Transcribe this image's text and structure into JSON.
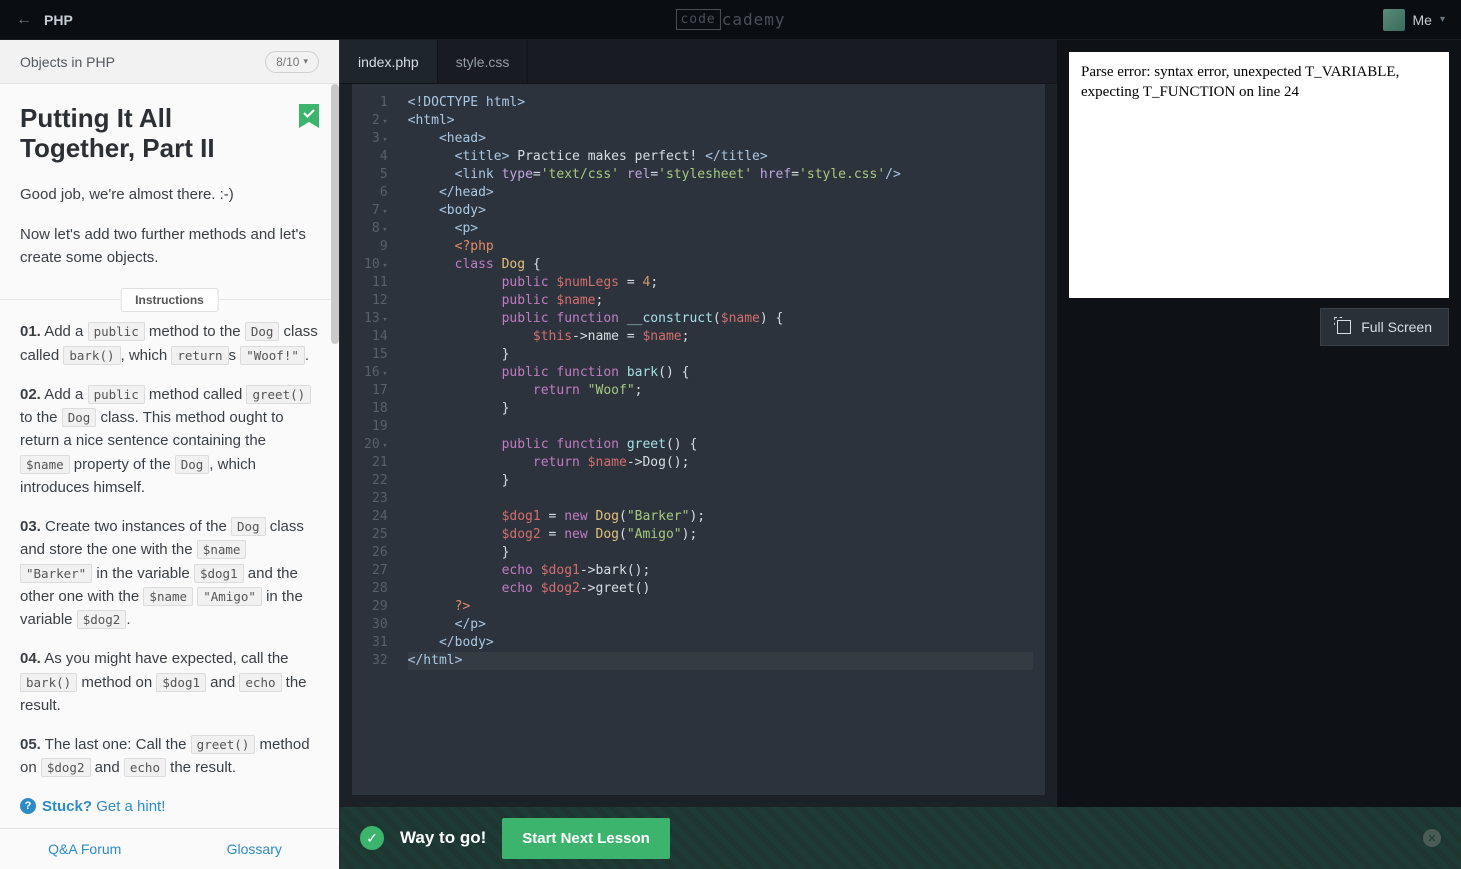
{
  "header": {
    "language": "PHP",
    "logo_left": "code",
    "logo_right": "cademy",
    "user_label": "Me"
  },
  "left": {
    "topic": "Objects in PHP",
    "progress": "8/10",
    "lesson_title": "Putting It All Together, Part II",
    "intro1": "Good job, we're almost there. :-)",
    "intro2": "Now let's add two further methods and let's create some objects.",
    "instructions_label": "Instructions",
    "i1_num": "01.",
    "i1_a": " Add a ",
    "i1_c1": "public",
    "i1_b": " method to the ",
    "i1_c2": "Dog",
    "i1_c": " class called ",
    "i1_c3": "bark()",
    "i1_d": ", which ",
    "i1_c4": "return",
    "i1_e": "s ",
    "i1_c5": "\"Woof!\"",
    "i1_f": ".",
    "i2_num": "02.",
    "i2_a": " Add a ",
    "i2_c1": "public",
    "i2_b": " method called ",
    "i2_c2": "greet()",
    "i2_c": " to the ",
    "i2_c3": "Dog",
    "i2_d": " class. This method ought to return a nice sentence containing the ",
    "i2_c4": "$name",
    "i2_e": " property of the ",
    "i2_c5": "Dog",
    "i2_f": ", which introduces himself.",
    "i3_num": "03.",
    "i3_a": " Create two instances of the ",
    "i3_c1": "Dog",
    "i3_b": " class and store the one with the ",
    "i3_c2": "$name",
    "i3_c": " ",
    "i3_c3": "\"Barker\"",
    "i3_d": " in the variable ",
    "i3_c4": "$dog1",
    "i3_e": " and the other one with the ",
    "i3_c5": "$name",
    "i3_f": " ",
    "i3_c6": "\"Amigo\"",
    "i3_g": " in the variable ",
    "i3_c7": "$dog2",
    "i3_h": ".",
    "i4_num": "04.",
    "i4_a": " As you might have expected, call the ",
    "i4_c1": "bark()",
    "i4_b": " method on ",
    "i4_c2": "$dog1",
    "i4_c": " and ",
    "i4_c3": "echo",
    "i4_d": " the result.",
    "i5_num": "05.",
    "i5_a": " The last one: Call the ",
    "i5_c1": "greet()",
    "i5_b": " method on ",
    "i5_c2": "$dog2",
    "i5_c": " and ",
    "i5_c3": "echo",
    "i5_d": " the result.",
    "stuck": "Stuck?",
    "hint": "Get a hint!",
    "qa": "Q&A Forum",
    "glossary": "Glossary"
  },
  "tabs": {
    "t1": "index.php",
    "t2": "style.css"
  },
  "code": {
    "l1a": "<!DOCTYPE html>",
    "l2a": "<html>",
    "l3a": "<head>",
    "l4a": "<title>",
    "l4b": " Practice makes perfect! ",
    "l4c": "</title>",
    "l5a": "<link",
    "l5b": " type",
    "l5c": "=",
    "l5d": "'text/css'",
    "l5e": " rel",
    "l5f": "=",
    "l5g": "'stylesheet'",
    "l5h": " href",
    "l5i": "=",
    "l5j": "'style.css'",
    "l5k": "/>",
    "l6a": "</head>",
    "l7a": "<body>",
    "l8a": "<p>",
    "l9a": "<?php",
    "l10a": "class",
    "l10b": " Dog ",
    "l10c": "{",
    "l11a": "public",
    "l11b": " $numLegs",
    "l11c": " = ",
    "l11d": "4",
    "l11e": ";",
    "l12a": "public",
    "l12b": " $name",
    "l12c": ";",
    "l13a": "public",
    "l13b": " function",
    "l13c": " __construct",
    "l13d": "(",
    "l13e": "$name",
    "l13f": ") {",
    "l14a": "$this",
    "l14b": "->name = ",
    "l14c": "$name",
    "l14d": ";",
    "l15a": "}",
    "l16a": "public",
    "l16b": " function",
    "l16c": " bark",
    "l16d": "() {",
    "l17a": "return",
    "l17b": " \"Woof\"",
    "l17c": ";",
    "l18a": "}",
    "l20a": "public",
    "l20b": " function",
    "l20c": " greet",
    "l20d": "() {",
    "l21a": "return",
    "l21b": " $name",
    "l21c": "->Dog();",
    "l22a": "}",
    "l24a": "$dog1",
    "l24b": " = ",
    "l24c": "new",
    "l24d": " Dog",
    "l24e": "(",
    "l24f": "\"Barker\"",
    "l24g": ");",
    "l25a": "$dog2",
    "l25b": " = ",
    "l25c": "new",
    "l25d": " Dog",
    "l25e": "(",
    "l25f": "\"Amigo\"",
    "l25g": ");",
    "l26a": "}",
    "l27a": "echo",
    "l27b": " $dog1",
    "l27c": "->bark();",
    "l28a": "echo",
    "l28b": " $dog2",
    "l28c": "->greet()",
    "l29a": "?>",
    "l30a": "</p>",
    "l31a": "</body>",
    "l32a": "</html>"
  },
  "gutter": [
    "1",
    "2",
    "3",
    "4",
    "5",
    "6",
    "7",
    "8",
    "9",
    "10",
    "11",
    "12",
    "13",
    "14",
    "15",
    "16",
    "17",
    "18",
    "19",
    "20",
    "21",
    "22",
    "23",
    "24",
    "25",
    "26",
    "27",
    "28",
    "29",
    "30",
    "31",
    "32"
  ],
  "output": {
    "error": "Parse error: syntax error, unexpected T_VARIABLE, expecting T_FUNCTION on line 24",
    "fullscreen": "Full Screen"
  },
  "bottom": {
    "msg": "Way to go!",
    "next": "Start Next Lesson"
  }
}
